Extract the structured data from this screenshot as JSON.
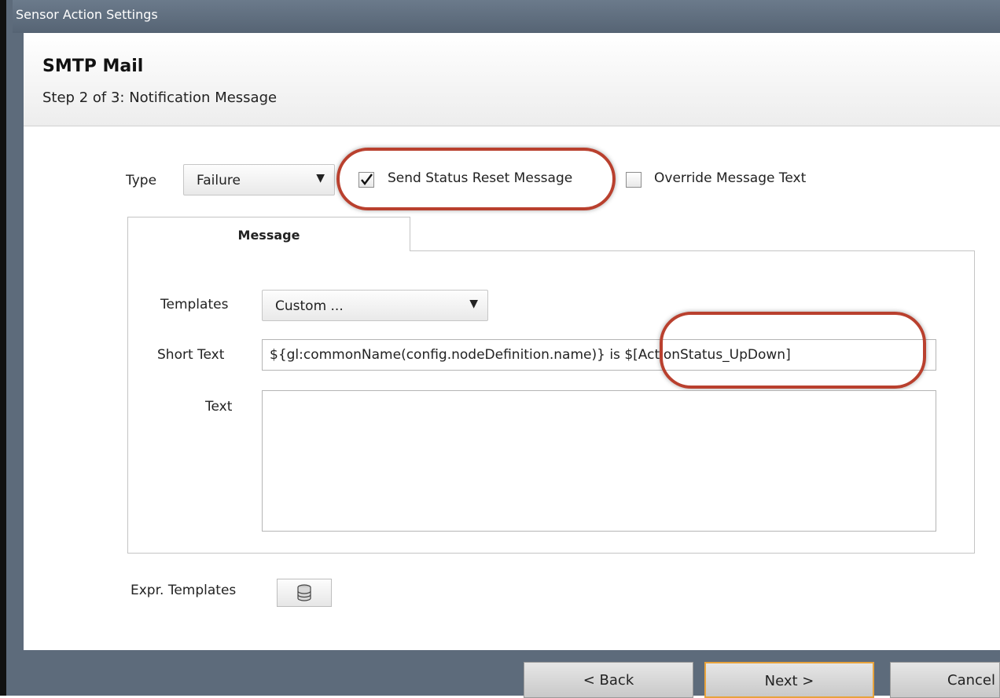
{
  "window": {
    "title": "Sensor Action Settings"
  },
  "header": {
    "title": "SMTP Mail",
    "subtitle": "Step 2 of 3: Notification Message"
  },
  "type_row": {
    "type_label": "Type",
    "type_value": "Failure",
    "send_status_reset_label": "Send Status Reset Message",
    "send_status_reset_checked": true,
    "override_label": "Override Message Text",
    "override_checked": false
  },
  "tab": {
    "label": "Message"
  },
  "form": {
    "templates_label": "Templates",
    "templates_value": "Custom ...",
    "short_text_label": "Short Text",
    "short_text_value": "${gl:commonName(config.nodeDefinition.name)} is $[ActionStatus_UpDown]",
    "text_label": "Text",
    "text_value": ""
  },
  "expr": {
    "label": "Expr. Templates",
    "icon": "database-icon"
  },
  "footer": {
    "back": "< Back",
    "next": "Next >",
    "cancel": "Cancel"
  },
  "colors": {
    "highlight_oval": "#b9402e",
    "next_border": "#e8a33c"
  }
}
